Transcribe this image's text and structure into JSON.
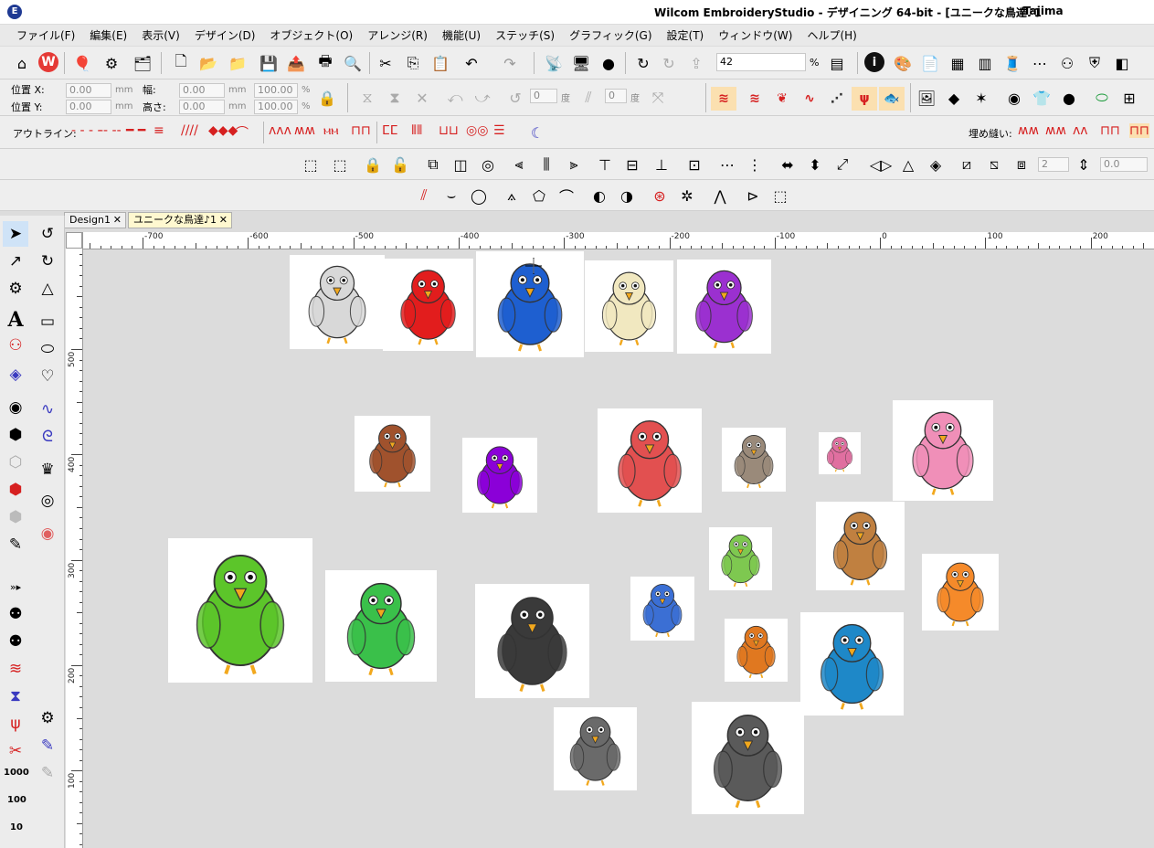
{
  "window": {
    "title": "Wilcom EmbroideryStudio - デザイニング 64-bit - [ユニークな鳥達♪1",
    "user": "Tajima"
  },
  "menu": [
    "ファイル(F)",
    "編集(E)",
    "表示(V)",
    "デザイン(D)",
    "オブジェクト(O)",
    "アレンジ(R)",
    "機能(U)",
    "ステッチ(S)",
    "グラフィック(G)",
    "設定(T)",
    "ウィンドウ(W)",
    "ヘルプ(H)"
  ],
  "toolbar": {
    "zoom_value": "42",
    "zoom_unit": "%"
  },
  "props": {
    "pos_x_label": "位置 X:",
    "pos_y_label": "位置 Y:",
    "width_label": "幅:",
    "height_label": "高さ:",
    "pos_x": "0.00",
    "pos_y": "0.00",
    "width": "0.00",
    "height": "0.00",
    "scale_w": "100.00",
    "scale_h": "100.00",
    "unit_mm": "mm",
    "unit_pct": "%",
    "rotate_value": "0",
    "slant_value": "0",
    "unit_deg": "度"
  },
  "outline": {
    "label": "アウトライン:",
    "fill_label": "埋め縫い:"
  },
  "arrange": {
    "count_value": "2",
    "spacing_value": "0.0"
  },
  "tabs": [
    {
      "label": "Design1",
      "active": false
    },
    {
      "label": "ユニークな鳥達♪1",
      "active": true
    }
  ],
  "ruler": {
    "h_labels": [
      "-700",
      "-600",
      "-500",
      "-400",
      "-300",
      "-200",
      "-100",
      "0",
      "100",
      "200"
    ],
    "v_labels": [
      "500",
      "400",
      "300",
      "200",
      "100"
    ]
  },
  "left_tools": {
    "counter_1000": "1000",
    "counter_100": "100",
    "counter_10": "10"
  },
  "birds": [
    {
      "name": "grey-owl",
      "color": "#d8d8d8"
    },
    {
      "name": "red-parrot",
      "color": "#e21d1d"
    },
    {
      "name": "blue-toucan",
      "color": "#1e5fd0"
    },
    {
      "name": "cream-owl",
      "color": "#f1e8c0"
    },
    {
      "name": "rainbow-bird",
      "color": "#9b30d0"
    },
    {
      "name": "brown-owl",
      "color": "#a0522d"
    },
    {
      "name": "purple-bat-bird",
      "color": "#8b00d8"
    },
    {
      "name": "colorful-crested-bird",
      "color": "#e25050"
    },
    {
      "name": "sparrow-flute",
      "color": "#9a8a7a"
    },
    {
      "name": "tiny-pink-bird",
      "color": "#e06fa0"
    },
    {
      "name": "pink-phoenix",
      "color": "#f08fb8"
    },
    {
      "name": "green-fluffy-bird",
      "color": "#5cc52a"
    },
    {
      "name": "green-hummingbird",
      "color": "#3ac04a"
    },
    {
      "name": "black-crow",
      "color": "#3a3a3a"
    },
    {
      "name": "blue-owl",
      "color": "#3b6fd4"
    },
    {
      "name": "small-green-bird",
      "color": "#7ec850"
    },
    {
      "name": "brown-horned-owl",
      "color": "#c08040"
    },
    {
      "name": "orange-phoenix",
      "color": "#f58a2a"
    },
    {
      "name": "orange-sparrow",
      "color": "#e07820"
    },
    {
      "name": "kingfisher",
      "color": "#1e88c8"
    },
    {
      "name": "grey-crow",
      "color": "#6a6a6a"
    },
    {
      "name": "grey-duck-bird",
      "color": "#5a5a5a"
    }
  ]
}
